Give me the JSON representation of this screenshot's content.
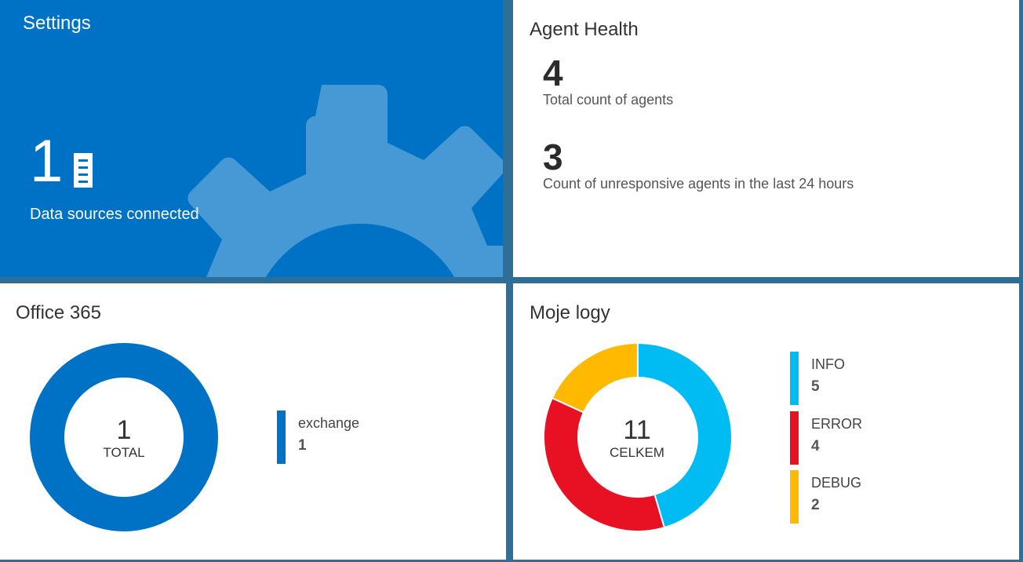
{
  "settings": {
    "title": "Settings",
    "count": "1",
    "label": "Data sources connected",
    "icon": "server-icon"
  },
  "agent_health": {
    "title": "Agent Health",
    "total_count": "4",
    "total_label": "Total count of agents",
    "unresponsive_count": "3",
    "unresponsive_label": "Count of unresponsive agents in the last 24 hours"
  },
  "office365": {
    "title": "Office 365",
    "center_value": "1",
    "center_label": "TOTAL",
    "legend": [
      {
        "name": "exchange",
        "value": "1",
        "color": "#0072c6"
      }
    ]
  },
  "logs": {
    "title": "Moje logy",
    "center_value": "11",
    "center_label": "CELKEM",
    "legend": [
      {
        "name": "INFO",
        "value": "5",
        "color": "#00bcf2"
      },
      {
        "name": "ERROR",
        "value": "4",
        "color": "#e81123"
      },
      {
        "name": "DEBUG",
        "value": "2",
        "color": "#ffb900"
      }
    ]
  },
  "chart_data": [
    {
      "type": "pie",
      "categories": [
        "exchange"
      ],
      "values": [
        1
      ],
      "colors": [
        "#0072c6"
      ]
    },
    {
      "type": "pie",
      "categories": [
        "INFO",
        "ERROR",
        "DEBUG"
      ],
      "values": [
        5,
        4,
        2
      ],
      "colors": [
        "#00bcf2",
        "#e81123",
        "#ffb900"
      ]
    }
  ]
}
